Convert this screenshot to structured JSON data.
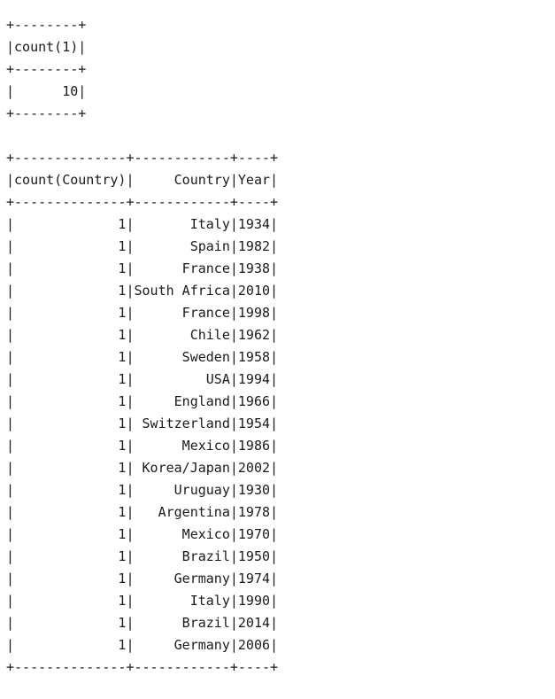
{
  "table1": {
    "border": "+--------+",
    "header": "|count(1)|",
    "rows": [
      "|      10|"
    ]
  },
  "table2": {
    "border": "+--------------+------------+----+",
    "header": "|count(Country)|     Country|Year|",
    "rows": [
      "|             1|       Italy|1934|",
      "|             1|       Spain|1982|",
      "|             1|      France|1938|",
      "|             1|South Africa|2010|",
      "|             1|      France|1998|",
      "|             1|       Chile|1962|",
      "|             1|      Sweden|1958|",
      "|             1|         USA|1994|",
      "|             1|     England|1966|",
      "|             1| Switzerland|1954|",
      "|             1|      Mexico|1986|",
      "|             1| Korea/Japan|2002|",
      "|             1|     Uruguay|1930|",
      "|             1|   Argentina|1978|",
      "|             1|      Mexico|1970|",
      "|             1|      Brazil|1950|",
      "|             1|     Germany|1974|",
      "|             1|       Italy|1990|",
      "|             1|      Brazil|2014|",
      "|             1|     Germany|2006|"
    ]
  }
}
